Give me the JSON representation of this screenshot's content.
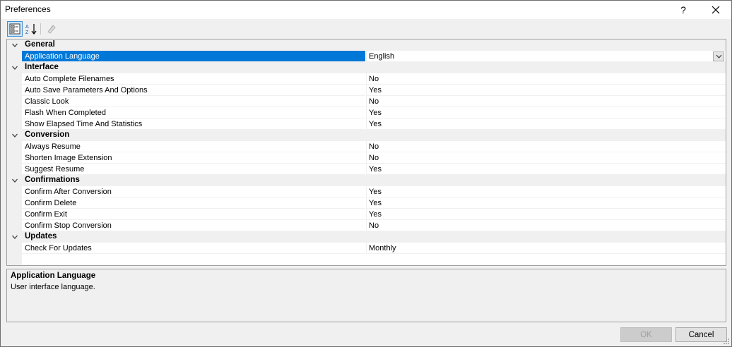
{
  "window": {
    "title": "Preferences",
    "help_label": "?",
    "close_label": "✕"
  },
  "toolbar": {
    "categorized_icon": "categorized-view-icon",
    "alphabetical_icon": "alphabetical-sort-icon",
    "property_pages_icon": "property-pages-icon"
  },
  "categories": [
    {
      "label": "General",
      "items": [
        {
          "name": "Application Language",
          "value": "English",
          "selected": true,
          "dropdown": true
        }
      ]
    },
    {
      "label": "Interface",
      "items": [
        {
          "name": "Auto Complete Filenames",
          "value": "No"
        },
        {
          "name": "Auto Save Parameters And Options",
          "value": "Yes"
        },
        {
          "name": "Classic Look",
          "value": "No"
        },
        {
          "name": "Flash When Completed",
          "value": "Yes"
        },
        {
          "name": "Show Elapsed Time And Statistics",
          "value": "Yes"
        }
      ]
    },
    {
      "label": "Conversion",
      "items": [
        {
          "name": "Always Resume",
          "value": "No"
        },
        {
          "name": "Shorten Image Extension",
          "value": "No"
        },
        {
          "name": "Suggest Resume",
          "value": "Yes"
        }
      ]
    },
    {
      "label": "Confirmations",
      "items": [
        {
          "name": "Confirm After Conversion",
          "value": "Yes"
        },
        {
          "name": "Confirm Delete",
          "value": "Yes"
        },
        {
          "name": "Confirm Exit",
          "value": "Yes"
        },
        {
          "name": "Confirm Stop Conversion",
          "value": "No"
        }
      ]
    },
    {
      "label": "Updates",
      "items": [
        {
          "name": "Check For Updates",
          "value": "Monthly"
        }
      ]
    }
  ],
  "help_pane": {
    "title": "Application Language",
    "description": "User interface language."
  },
  "buttons": {
    "ok_label": "OK",
    "cancel_label": "Cancel"
  },
  "colors": {
    "selection": "#0078d7",
    "category_bg": "#f0f0f0"
  }
}
